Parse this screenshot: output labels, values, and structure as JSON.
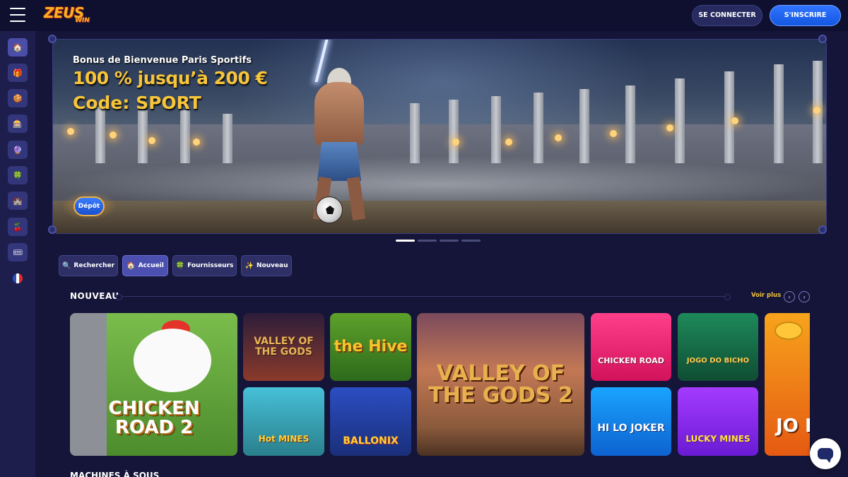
{
  "header": {
    "logo_main": "ZEUS",
    "logo_sub": "WIN",
    "login_label": "SE CONNECTER",
    "register_label": "S'INSCRIRE"
  },
  "sidebar": {
    "items": [
      {
        "icon": "home-icon",
        "glyph": "🏠",
        "active": true
      },
      {
        "icon": "gift-icon",
        "glyph": "🎁"
      },
      {
        "icon": "cookie-icon",
        "glyph": "🍪"
      },
      {
        "icon": "slot-machine-icon",
        "glyph": "🎰"
      },
      {
        "icon": "ball-icon",
        "glyph": "🔮"
      },
      {
        "icon": "clover-icon",
        "glyph": "🍀"
      },
      {
        "icon": "castle-icon",
        "glyph": "🏰"
      },
      {
        "icon": "cherries-icon",
        "glyph": "🍒"
      },
      {
        "icon": "ticket-icon",
        "glyph": "🎟"
      }
    ],
    "language_icon": "france-flag-icon",
    "flag_colors": [
      "#2a52be",
      "#ffffff",
      "#e4282a"
    ]
  },
  "banner": {
    "line1": "Bonus de Bienvenue Paris Sportifs",
    "line2": "100 % jusqu’à 200 €",
    "line3": "Code: SPORT",
    "cta_label": "Dépôt",
    "slides_count": 4,
    "active_slide": 0
  },
  "tabs": [
    {
      "label": "Rechercher",
      "icon": "search-icon",
      "glyph": "🔍"
    },
    {
      "label": "Accueil",
      "icon": "home-icon",
      "glyph": "🏠",
      "active": true
    },
    {
      "label": "Fournisseurs",
      "icon": "clover-icon",
      "glyph": "🍀"
    },
    {
      "label": "Nouveau",
      "icon": "star-icon",
      "glyph": "✨"
    }
  ],
  "section": {
    "title": "NOUVEAU",
    "see_more": "Voir plus",
    "prev_icon": "chevron-left-icon",
    "next_icon": "chevron-right-icon"
  },
  "games": {
    "chicken_road_2": "CHICKEN ROAD 2",
    "valley_small": "VALLEY OF THE GODS",
    "the_hive": "the Hive",
    "hot_mines": "Hot MINES",
    "ballonix": "BALLONIX",
    "valley_2": "VALLEY OF THE GODS 2",
    "chicken_road": "CHICKEN ROAD",
    "jogo_do_bicho": "JOGO DO BICHO",
    "hilo_joker": "HI LO JOKER",
    "lucky_mines": "LUCKY MINES",
    "partial": "JO P"
  },
  "next_section": {
    "title": "MACHINES À SOUS"
  },
  "colors": {
    "page_bg": "#141538",
    "header_bg": "#0f1030",
    "sidebar_bg": "#1d1e4b",
    "accent_blue": "#2f74ff",
    "accent_gold": "#f7c53a"
  }
}
